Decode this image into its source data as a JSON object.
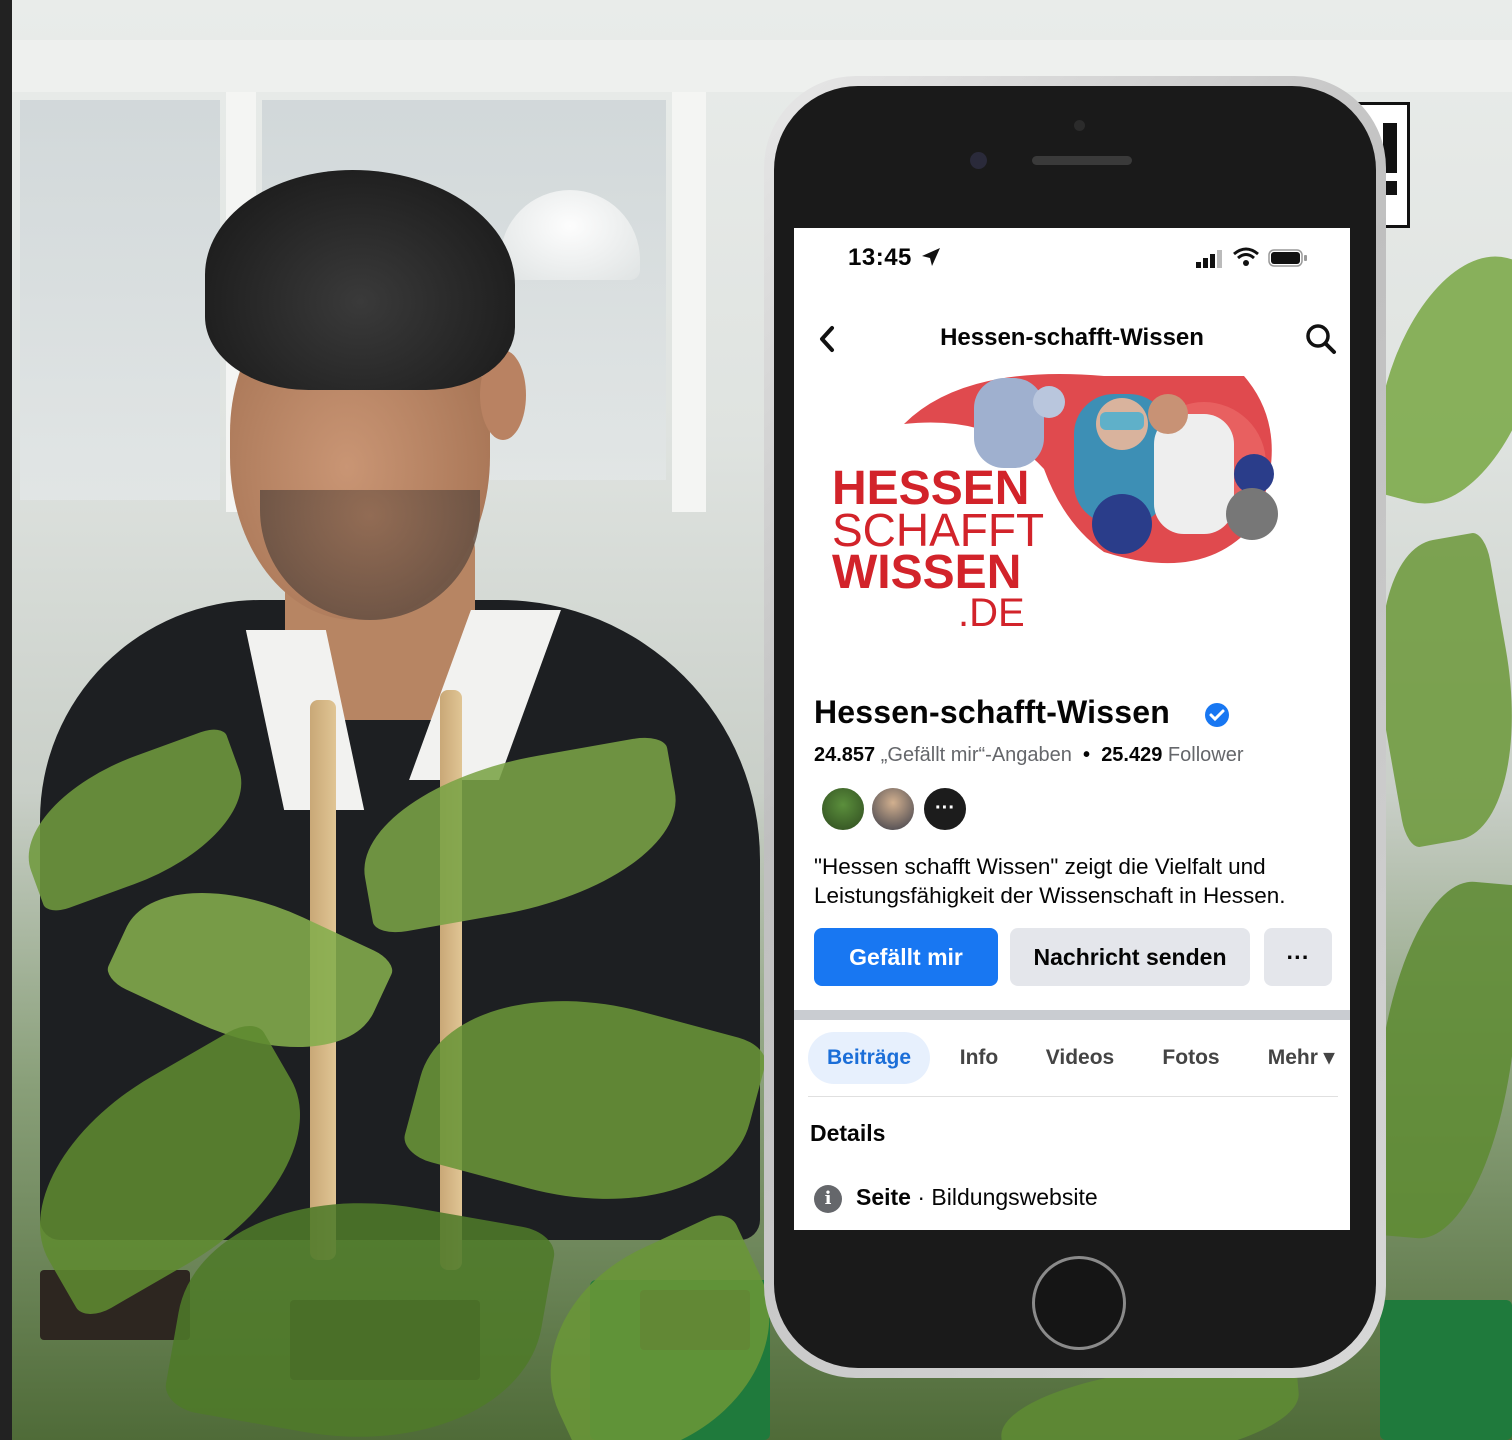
{
  "logo": {
    "text": "izc!"
  },
  "status_bar": {
    "time": "13:45"
  },
  "nav": {
    "title": "Hessen-schafft-Wissen"
  },
  "cover": {
    "line1": "HESSEN",
    "line2": "SCHAFFT",
    "line3": "WISSEN",
    "line4": ".DE"
  },
  "profile": {
    "name": "Hessen-schafft-Wissen",
    "likes_count": "24.857",
    "likes_label": "„Gefällt mir“-Angaben",
    "separator": "•",
    "followers_count": "25.429",
    "followers_label": "Follower",
    "more_friends": "···",
    "description": "\"Hessen schafft Wissen\" zeigt die Vielfalt und Leistungsfähigkeit der Wissenschaft in Hessen."
  },
  "buttons": {
    "like": "Gefällt mir",
    "message": "Nachricht senden",
    "more": "···"
  },
  "tabs": [
    "Beiträge",
    "Info",
    "Videos",
    "Fotos",
    "Mehr ▾"
  ],
  "details": {
    "heading": "Details",
    "info_icon": "i",
    "page_label": "Seite",
    "page_type": " · Bildungswebsite"
  },
  "colors": {
    "facebook_blue": "#1877f2",
    "cover_red": "#d2232a"
  }
}
